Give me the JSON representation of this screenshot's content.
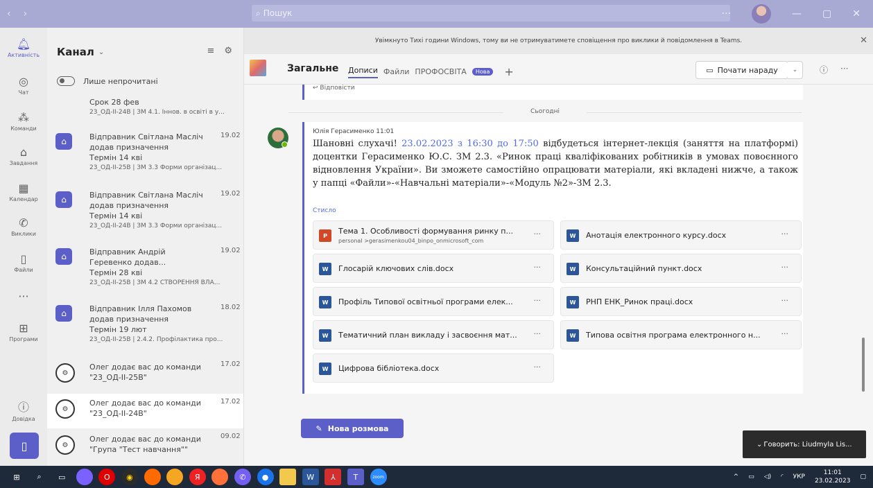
{
  "titlebar": {
    "search_placeholder": "Пошук"
  },
  "rail": {
    "items": [
      {
        "label": "Активність",
        "icon": "bell-icon"
      },
      {
        "label": "Чат",
        "icon": "chat-icon"
      },
      {
        "label": "Команди",
        "icon": "teams-icon"
      },
      {
        "label": "Завдання",
        "icon": "assignments-icon"
      },
      {
        "label": "Календар",
        "icon": "calendar-icon"
      },
      {
        "label": "Виклики",
        "icon": "phone-icon"
      },
      {
        "label": "Файли",
        "icon": "file-icon"
      },
      {
        "label": "Програми",
        "icon": "apps-icon"
      },
      {
        "label": "Довідка",
        "icon": "help-icon"
      }
    ]
  },
  "feed": {
    "title": "Канал",
    "toggle_label": "Лише непрочитані",
    "items": [
      {
        "line1": "Срок 28 фев",
        "line2": "23_ОД-ІІ-24В | ЗМ 4.1. Іннов. в освіті в у...",
        "date": "",
        "line0": ""
      },
      {
        "line0": "Відправник Світлана Масліч",
        "date": "19.02",
        "line1": "додав призначення",
        "line2": "Термін 14 кві",
        "line3": "23_ОД-ІІ-25В | ЗМ 3.3 Форми організац..."
      },
      {
        "line0": "Відправник Світлана Масліч",
        "date": "19.02",
        "line1": "додав призначення",
        "line2": "Термін 14 кві",
        "line3": "23_ОД-ІІ-24В | ЗМ 3.3 Форми організац..."
      },
      {
        "line0": "Відправник Андрій",
        "date": "19.02",
        "line1": "Геревенко додав...",
        "line2": "Термін 28 кві",
        "line3": "23_ОД-ІІ-25В | ЗМ 4.2 СТВОРЕННЯ ВЛА..."
      },
      {
        "line0": "Відправник Ілля Пахомов",
        "date": "18.02",
        "line1": "додав призначення",
        "line2": "Термін 19 лют",
        "line3": "23_ОД-ІІ-25В | 2.4.2. Профілактика про..."
      },
      {
        "line0": "Олег додає вас до команди",
        "date": "17.02",
        "line1": "\"23_ОД-ІІ-25В\""
      },
      {
        "line0": "Олег додає вас до команди",
        "date": "17.02",
        "line1": "\"23_ОД-ІІ-24В\""
      },
      {
        "line0": "Олег додає вас до команди",
        "date": "09.02",
        "line1": "\"Група \"Тест навчання\"\""
      }
    ]
  },
  "banner": {
    "text": "Увімкнуто Тихі години Windows, тому ви не отримуватимете сповіщення про виклики й повідомлення в Teams."
  },
  "channel": {
    "name": "Загальне",
    "tabs": [
      "Дописи",
      "Файли",
      "ПРОФОСВІТА"
    ],
    "tab_badge": "Нова",
    "add_tab": "+",
    "meet_button": "Почати нараду"
  },
  "conversation": {
    "prev_reply": "Відповісти",
    "day_divider": "Сьогодні",
    "post": {
      "author_time": "Юлія Герасименко 11:01",
      "body_pre": "Шановні слухачі! ",
      "body_link": "23.02.2023 з 16:30 до 17:50",
      "body_post": " відбудеться інтернет-лекція (заняття на платформі) доцентки Герасименко Ю.С. ЗМ 2.3. «Ринок праці кваліфікованих робітників в умовах повоєнного відновлення України». Ви зможете самостійно опрацювати матеріали, які вкладені нижче, а також у папці «Файли»-«Навчальні матеріали»-«Модуль №2»-ЗМ 2.3.",
      "collapse": "Стисло"
    },
    "attachments": [
      {
        "name": "Тема 1. Особливості формування ринку п...",
        "path": "personal >gerasimenkou04_binpo_onmicrosoft_com",
        "type": "P"
      },
      {
        "name": "Анотація електронного курсу.docx",
        "type": "W"
      },
      {
        "name": "Глосарій ключових слів.docx",
        "type": "W"
      },
      {
        "name": "Консультаційний пункт.docx",
        "type": "W"
      },
      {
        "name": "Профіль Типової освітньої програми елек...",
        "type": "W"
      },
      {
        "name": "РНП ЕНК_Ринок праці.docx",
        "type": "W"
      },
      {
        "name": "Тематичний план викладу і засвоєння мат...",
        "type": "W"
      },
      {
        "name": "Типова освітня програма електронного н...",
        "type": "W"
      },
      {
        "name": "Цифрова бібліотека.docx",
        "type": "W"
      }
    ],
    "more_glyph": "···",
    "new_conversation": "Нова розмова"
  },
  "toast": {
    "text": "Говорить: Liudmyla Lis..."
  },
  "taskbar": {
    "language": "УКР",
    "time": "11:01",
    "date": "23.02.2023"
  },
  "colors": {
    "accent": "#5b5fc7",
    "titlebar": "#a9aad3",
    "taskbar": "#1e2a3a"
  }
}
